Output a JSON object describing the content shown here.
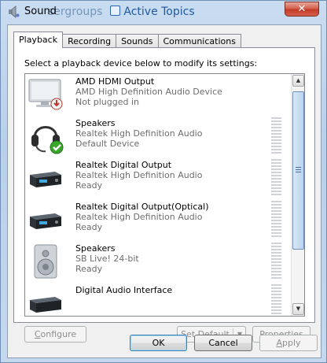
{
  "window": {
    "title": "Sound",
    "close_label": "✕"
  },
  "background": {
    "text_1": "sergroups",
    "text_2": "Active Topics"
  },
  "tabs": [
    {
      "label": "Playback",
      "active": true
    },
    {
      "label": "Recording",
      "active": false
    },
    {
      "label": "Sounds",
      "active": false
    },
    {
      "label": "Communications",
      "active": false
    }
  ],
  "playback": {
    "instruction": "Select a playback device below to modify its settings:",
    "devices": [
      {
        "name": "AMD HDMI Output",
        "driver": "AMD High Definition Audio Device",
        "status": "Not plugged in",
        "icon": "monitor-icon",
        "badge": "unplugged-badge-icon"
      },
      {
        "name": "Speakers",
        "driver": "Realtek High Definition Audio",
        "status": "Default Device",
        "icon": "headset-icon",
        "badge": "default-check-icon"
      },
      {
        "name": "Realtek Digital Output",
        "driver": "Realtek High Definition Audio",
        "status": "Ready",
        "icon": "receiver-icon"
      },
      {
        "name": "Realtek Digital Output(Optical)",
        "driver": "Realtek High Definition Audio",
        "status": "Ready",
        "icon": "receiver-icon"
      },
      {
        "name": "Speakers",
        "driver": "SB Live! 24-bit",
        "status": "Ready",
        "icon": "speaker-icon"
      },
      {
        "name": "Digital Audio Interface",
        "driver": "",
        "status": "",
        "icon": "receiver-icon"
      }
    ]
  },
  "buttons": {
    "configure": {
      "prefix": "",
      "mnemonic": "C",
      "rest": "onfigure"
    },
    "set_default": {
      "prefix": "",
      "mnemonic": "S",
      "rest": "et Default"
    },
    "properties": {
      "prefix": "",
      "mnemonic": "P",
      "rest": "roperties"
    },
    "ok": "OK",
    "cancel": "Cancel",
    "apply": {
      "prefix": "",
      "mnemonic": "A",
      "rest": "pply"
    }
  },
  "colors": {
    "accent": "#3c7fb1",
    "close": "#c13a26",
    "default_check": "#3aa62a",
    "unplugged": "#c0392b"
  }
}
